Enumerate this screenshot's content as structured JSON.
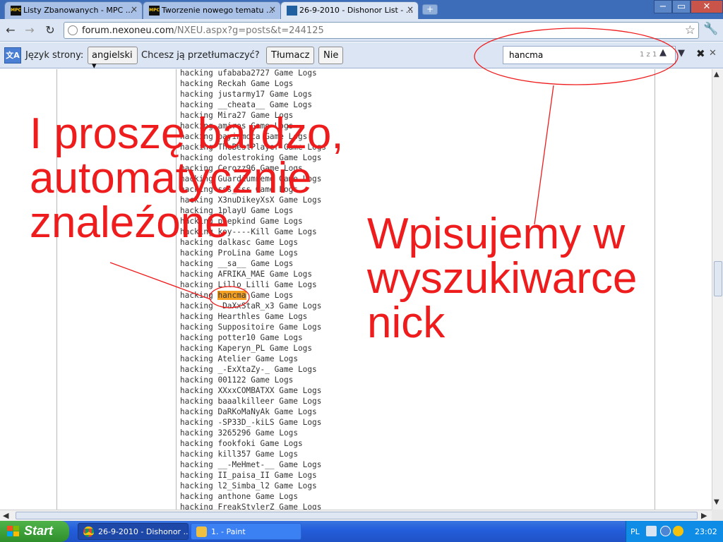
{
  "browser": {
    "tabs": [
      {
        "title": "Listy Zbanowanych - MPC ...",
        "favicon": "mpc-icon"
      },
      {
        "title": "Tworzenie nowego tematu ...",
        "favicon": "mpc-icon"
      },
      {
        "title": "26-9-2010 - Dishonor List - ...",
        "favicon": "page-icon"
      }
    ],
    "active_tab": 2,
    "tab_close": "×",
    "newtab_glyph": "+",
    "window_buttons": {
      "minimize": "−",
      "maximize": "▭",
      "close": "✕"
    },
    "nav": {
      "back": "←",
      "forward": "→",
      "reload": "↻"
    },
    "url_host": "forum.nexoneu.com",
    "url_path": "/NXEU.aspx?g=posts&t=244125",
    "star": "☆",
    "wrench": "🔧"
  },
  "translate_bar": {
    "prompt_prefix": "Język strony:",
    "language": "angielski ▾",
    "question": "Chcesz ją przetłumaczyć?",
    "translate_button": "Tłumacz",
    "no_button": "Nie"
  },
  "find_bar": {
    "query": "hancma",
    "match_count": "1 z 1",
    "prev": "▲",
    "next": "▼",
    "close": "✖",
    "close2": "✕"
  },
  "log_items": [
    {
      "before": "hacking ",
      "nick": "ufababa2727",
      "after": " Game Logs"
    },
    {
      "before": "hacking ",
      "nick": "Reckah",
      "after": " Game Logs"
    },
    {
      "before": "hacking ",
      "nick": "justarmy17",
      "after": " Game Logs"
    },
    {
      "before": "hacking ",
      "nick": "__cheata__",
      "after": " Game Logs"
    },
    {
      "before": "hacking ",
      "nick": "Mira27",
      "after": " Game Logs"
    },
    {
      "before": "hacking ",
      "nick": "amiros",
      "after": " Game Logs"
    },
    {
      "before": "hacking ",
      "nick": "bayinmoca",
      "after": " Game Logs"
    },
    {
      "before": "hacking ",
      "nick": "TheBestPlayer",
      "after": " Game Logs"
    },
    {
      "before": "hacking ",
      "nick": "dolestroking",
      "after": " Game Logs"
    },
    {
      "before": "hacking ",
      "nick": "Cerozz96",
      "after": " Game Logs"
    },
    {
      "before": "hacking ",
      "nick": "Guardiumnemo",
      "after": " Game Logs"
    },
    {
      "before": "hacking ",
      "nick": "sss_sss",
      "after": " Game Logs"
    },
    {
      "before": "hacking ",
      "nick": "X3nuDikeyXsX",
      "after": " Game Logs"
    },
    {
      "before": "hacking ",
      "nick": "1playU",
      "after": " Game Logs"
    },
    {
      "before": "hacking ",
      "nick": "poepkind",
      "after": " Game Logs"
    },
    {
      "before": "hacking ",
      "nick": "koy----Kill",
      "after": " Game Logs"
    },
    {
      "before": "hacking ",
      "nick": "dalkasc",
      "after": " Game Logs"
    },
    {
      "before": "hacking ",
      "nick": "ProLina",
      "after": " Game Logs"
    },
    {
      "before": "hacking ",
      "nick": "__sa__",
      "after": " Game Logs"
    },
    {
      "before": "hacking ",
      "nick": "AFRIKA_MAE",
      "after": " Game Logs"
    },
    {
      "before": "hacking ",
      "nick": "Lillo_Lilli",
      "after": " Game Logs"
    },
    {
      "before": "hacking ",
      "nick": "hancma",
      "after": " Game Logs",
      "highlight": true
    },
    {
      "before": "hacking ",
      "nick": "-DaXxStaR_x3",
      "after": " Game Logs"
    },
    {
      "before": "hacking ",
      "nick": "Hearthles",
      "after": " Game Logs"
    },
    {
      "before": "hacking ",
      "nick": "Suppositoire",
      "after": " Game Logs"
    },
    {
      "before": "hacking ",
      "nick": "potter10",
      "after": " Game Logs"
    },
    {
      "before": "hacking ",
      "nick": "Kaperyn_PL",
      "after": " Game Logs"
    },
    {
      "before": "hacking ",
      "nick": "Atelier",
      "after": " Game Logs"
    },
    {
      "before": "hacking ",
      "nick": "_-ExXtaZy-_",
      "after": " Game Logs"
    },
    {
      "before": "hacking ",
      "nick": "001122",
      "after": " Game Logs"
    },
    {
      "before": "hacking ",
      "nick": "XXxxCOMBATXX",
      "after": " Game Logs"
    },
    {
      "before": "hacking ",
      "nick": "baaalkilleer",
      "after": " Game Logs"
    },
    {
      "before": "hacking ",
      "nick": "DaRKoMaNyAk",
      "after": " Game Logs"
    },
    {
      "before": "hacking ",
      "nick": "-SP33D_-kiLS",
      "after": " Game Logs"
    },
    {
      "before": "hacking ",
      "nick": "3265296",
      "after": " Game Logs"
    },
    {
      "before": "hacking ",
      "nick": "fookfoki",
      "after": " Game Logs"
    },
    {
      "before": "hacking ",
      "nick": "kill357",
      "after": " Game Logs"
    },
    {
      "before": "hacking ",
      "nick": "__-MeHmet-__",
      "after": " Game Logs"
    },
    {
      "before": "hacking ",
      "nick": "II_paisa_II",
      "after": " Game Logs"
    },
    {
      "before": "hacking ",
      "nick": "l2_Simba_l2",
      "after": " Game Logs"
    },
    {
      "before": "hacking ",
      "nick": "anthone",
      "after": " Game Logs"
    },
    {
      "before": "hacking ",
      "nick": "FreakStylerZ",
      "after": " Game Logs"
    }
  ],
  "annotations": {
    "left_lines": [
      "I proszę bardzo,",
      "automatycznie",
      "znaleźone"
    ],
    "right_lines": [
      "Wpisujemy w",
      "wyszukiwarce",
      "nick"
    ],
    "color": "#ee1c1c"
  },
  "taskbar": {
    "start_label": "Start",
    "tasks": [
      {
        "label": "26-9-2010 - Dishonor ...",
        "icon": "chrome-icon"
      },
      {
        "label": "1. - Paint",
        "icon": "paint-icon"
      }
    ],
    "language": "PL",
    "time": "23:02"
  },
  "scroll": {
    "up": "▲",
    "down": "▼",
    "left": "◀",
    "right": "▶",
    "vertical_position": 0.44
  }
}
